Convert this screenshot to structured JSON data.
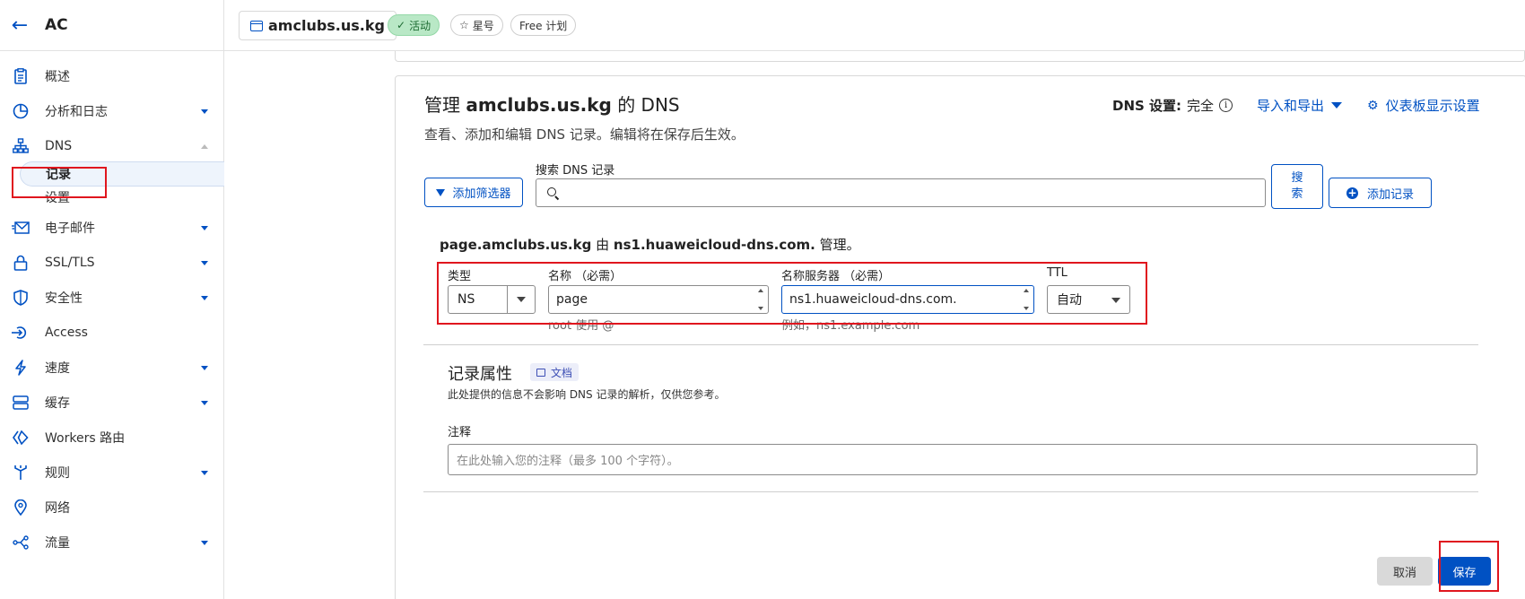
{
  "sidebar": {
    "account_name": "AC",
    "items": [
      {
        "label": "概述",
        "icon": "clipboard-icon"
      },
      {
        "label": "分析和日志",
        "icon": "chart-icon"
      },
      {
        "label": "DNS",
        "icon": "network-icon"
      },
      {
        "label": "电子邮件",
        "icon": "email-icon"
      },
      {
        "label": "SSL/TLS",
        "icon": "lock-icon"
      },
      {
        "label": "安全性",
        "icon": "shield-icon"
      },
      {
        "label": "Access",
        "icon": "access-icon"
      },
      {
        "label": "速度",
        "icon": "bolt-icon"
      },
      {
        "label": "缓存",
        "icon": "cache-icon"
      },
      {
        "label": "Workers 路由",
        "icon": "workers-icon"
      },
      {
        "label": "规则",
        "icon": "rules-icon"
      },
      {
        "label": "网络",
        "icon": "pin-icon"
      },
      {
        "label": "流量",
        "icon": "traffic-icon"
      }
    ],
    "dns_sub": [
      {
        "label": "记录"
      },
      {
        "label": "设置"
      }
    ]
  },
  "topbar": {
    "domain": "amclubs.us.kg",
    "status": "活动",
    "star": "星号",
    "plan": "Free 计划"
  },
  "card": {
    "title_prefix": "管理",
    "title_domain": "amclubs.us.kg",
    "title_suffix": "的 DNS",
    "subtitle": "查看、添加和编辑 DNS 记录。编辑将在保存后生效。",
    "dns_setting_label": "DNS 设置:",
    "dns_setting_value": "完全",
    "import_export": "导入和导出",
    "dashboard_settings": "仪表板显示设置",
    "search_label": "搜索 DNS 记录",
    "filter_button": "添加筛选器",
    "search_button": "搜索",
    "add_record_button": "添加记录"
  },
  "form": {
    "managed_subdomain": "page.amclubs.us.kg",
    "managed_by": "由",
    "managed_ns": "ns1.huaweicloud-dns.com.",
    "managed_suffix": "管理。",
    "type_label": "类型",
    "type_value": "NS",
    "name_label": "名称 （必需）",
    "name_value": "page",
    "name_hint": "root 使用 @",
    "ns_label": "名称服务器 （必需）",
    "ns_value": "ns1.huaweicloud-dns.com.",
    "ns_hint": "例如，ns1.example.com",
    "ttl_label": "TTL",
    "ttl_value": "自动",
    "attributes_title": "记录属性",
    "docs_badge": "文档",
    "attributes_sub": "此处提供的信息不会影响 DNS 记录的解析，仅供您参考。",
    "note_label": "注释",
    "note_placeholder": "在此处输入您的注释（最多 100 个字符）。",
    "cancel": "取消",
    "save": "保存"
  },
  "colors": {
    "accent": "#0051c3",
    "highlight": "#e0161e",
    "active_badge": "#b9e8c6"
  }
}
